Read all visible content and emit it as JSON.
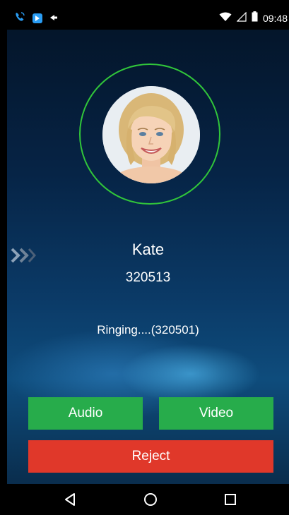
{
  "status_bar": {
    "time": "09:48",
    "icons": [
      "phone-call-icon",
      "app-notification-icon",
      "notification-arrow-icon",
      "wifi-icon",
      "signal-icon",
      "battery-icon"
    ]
  },
  "call": {
    "caller_name": "Kate",
    "caller_number": "320513",
    "status": "Ringing....(320501)"
  },
  "buttons": {
    "audio": "Audio",
    "video": "Video",
    "reject": "Reject"
  },
  "navigation": {
    "icons": [
      "back-icon",
      "home-icon",
      "recent-apps-icon"
    ]
  },
  "colors": {
    "accept_green": "#27ac4b",
    "reject_red": "#e0382a",
    "ring_green": "#31c63a"
  }
}
